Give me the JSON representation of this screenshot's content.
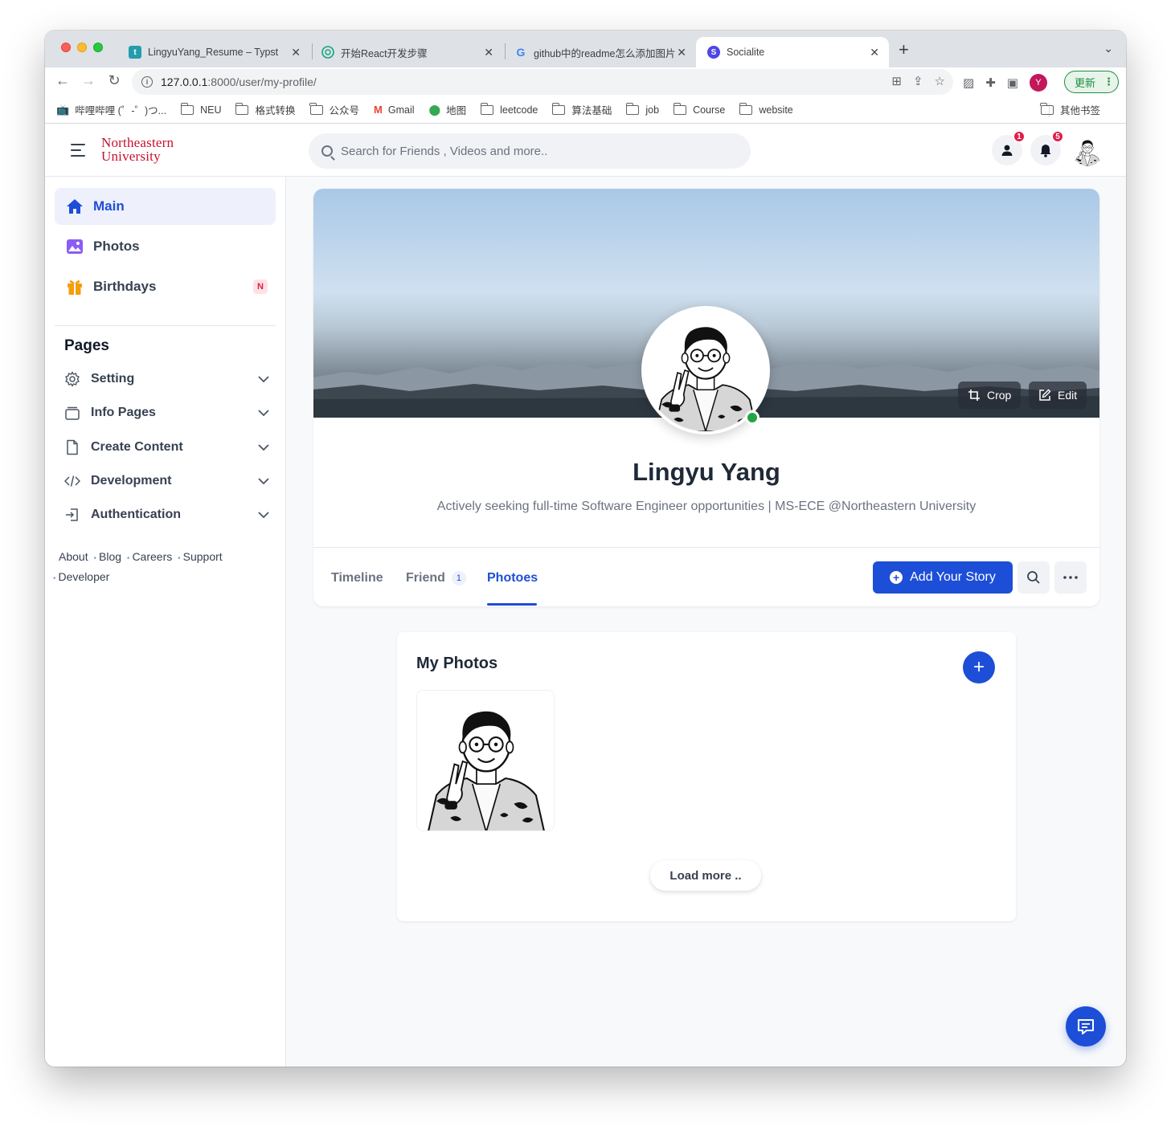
{
  "browser": {
    "tabs": [
      {
        "title": "LingyuYang_Resume – Typst",
        "favicon_letter": "t",
        "favicon_color": "#239dad",
        "active": false
      },
      {
        "title": "开始React开发步骤",
        "favicon_letter": "",
        "favicon_color": "#ffffff",
        "active": false
      },
      {
        "title": "github中的readme怎么添加图片",
        "favicon_letter": "G",
        "favicon_color": "#ffffff",
        "active": false
      },
      {
        "title": "Socialite",
        "favicon_letter": "S",
        "favicon_color": "#4f46e5",
        "active": true
      }
    ],
    "url_host": "127.0.0.1",
    "url_path": ":8000/user/my-profile/",
    "profile_initial": "Y",
    "update_label": "更新",
    "bookmarks": [
      {
        "label": "哔哩哔哩 (゜-゜)つ...",
        "type": "site"
      },
      {
        "label": "NEU",
        "type": "folder"
      },
      {
        "label": "格式转换",
        "type": "folder"
      },
      {
        "label": "公众号",
        "type": "folder"
      },
      {
        "label": "Gmail",
        "type": "site"
      },
      {
        "label": "地图",
        "type": "site"
      },
      {
        "label": "leetcode",
        "type": "folder"
      },
      {
        "label": "算法基础",
        "type": "folder"
      },
      {
        "label": "job",
        "type": "folder"
      },
      {
        "label": "Course",
        "type": "folder"
      },
      {
        "label": "website",
        "type": "folder"
      }
    ],
    "other_bookmarks": "其他书签"
  },
  "header": {
    "logo_line1": "Northeastern",
    "logo_line2": "University",
    "search_placeholder": "Search for Friends , Videos and more..",
    "friend_requests_count": "1",
    "notifications_count": "5"
  },
  "sidebar": {
    "main_items": [
      {
        "label": "Main",
        "icon": "home-icon",
        "active": true
      },
      {
        "label": "Photos",
        "icon": "photo-icon",
        "active": false
      },
      {
        "label": "Birthdays",
        "icon": "gift-icon",
        "active": false,
        "badge": "N"
      }
    ],
    "pages_title": "Pages",
    "pages": [
      {
        "label": "Setting",
        "icon": "gear-icon"
      },
      {
        "label": "Info Pages",
        "icon": "layers-icon"
      },
      {
        "label": "Create Content",
        "icon": "document-icon"
      },
      {
        "label": "Development",
        "icon": "code-icon"
      },
      {
        "label": "Authentication",
        "icon": "login-icon"
      }
    ],
    "footer": [
      "About",
      "Blog",
      "Careers",
      "Support",
      "Developer"
    ]
  },
  "profile": {
    "name": "Lingyu Yang",
    "bio": "Actively seeking full-time Software Engineer opportunities | MS-ECE @Northeastern University",
    "crop_label": "Crop",
    "edit_label": "Edit",
    "online": true,
    "tabs": [
      {
        "label": "Timeline"
      },
      {
        "label": "Friend",
        "count": "1"
      },
      {
        "label": "Photoes",
        "active": true
      }
    ],
    "add_story_label": "Add Your Story"
  },
  "photos": {
    "title": "My Photos",
    "load_more_label": "Load more .."
  },
  "colors": {
    "accent": "#1d4ed8",
    "brand_red": "#c8102e",
    "badge_red": "#e11d48",
    "online_green": "#22a447"
  }
}
